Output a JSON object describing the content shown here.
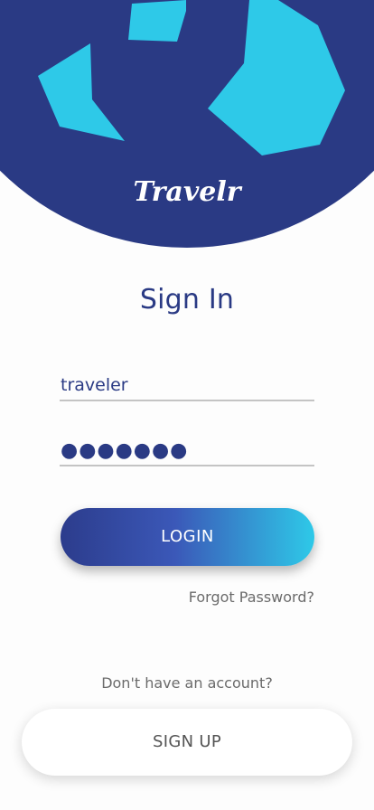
{
  "app": {
    "logo_text": "Travelr",
    "colors": {
      "primary": "#2a3a84",
      "accent": "#2ec9e8",
      "text_muted": "#6b6b6b"
    }
  },
  "signin": {
    "title": "Sign In",
    "username_value": "traveler",
    "password_value": "●●●●●●●",
    "login_label": "LOGIN",
    "forgot_label": "Forgot Password?"
  },
  "signup": {
    "prompt": "Don't have an account?",
    "button_label": "SIGN UP"
  }
}
